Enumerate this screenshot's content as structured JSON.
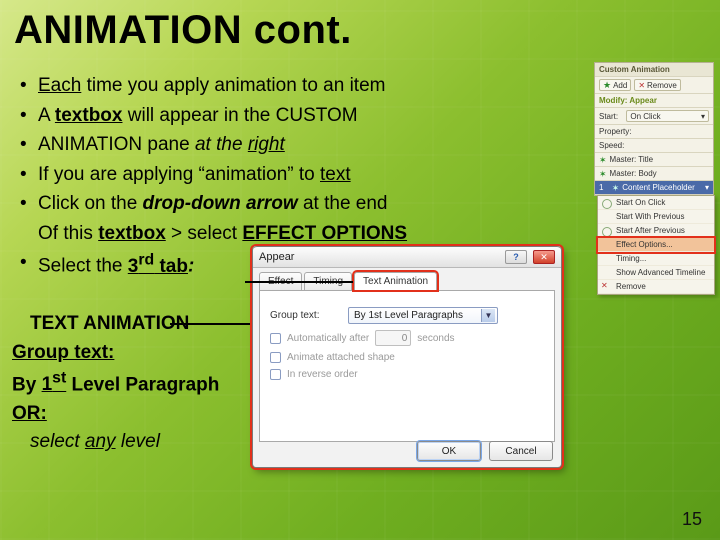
{
  "title": "ANIMATION cont.",
  "bullets": [
    "Each time you apply animation to an item",
    "A textbox will appear in the CUSTOM",
    "ANIMATION pane at the right",
    "If you are applying “animation” to text",
    "Click on the drop-down arrow at the end",
    "Of this textbox > select EFFECT OPTIONS",
    "Select the 3rd tab:"
  ],
  "subtext": {
    "l1": "TEXT ANIMATION",
    "l2": "Group text:",
    "l3": "By 1st Level Paragraph",
    "l4": "OR:",
    "l5": "select any level"
  },
  "pagenum": "15",
  "capane": {
    "header": "Custom Animation",
    "add": "Add",
    "remove": "Remove",
    "modify": "Modify: Appear",
    "start_label": "Start:",
    "start_value": "On Click",
    "prop_label": "Property:",
    "speed_label": "Speed:",
    "items": [
      "Master: Title",
      "Master: Body",
      "Content Placeholder"
    ],
    "sel_index": "1",
    "menu": {
      "m1": "Start On Click",
      "m2": "Start With Previous",
      "m3": "Start After Previous",
      "m4": "Effect Options...",
      "m5": "Timing...",
      "m6": "Show Advanced Timeline",
      "m7": "Remove"
    }
  },
  "dialog": {
    "title": "Appear",
    "tabs": {
      "t1": "Effect",
      "t2": "Timing",
      "t3": "Text Animation"
    },
    "group_label": "Group text:",
    "group_value": "By 1st Level Paragraphs",
    "auto_label": "Automatically after",
    "auto_value": "0",
    "auto_unit": "seconds",
    "shape_label": "Animate attached shape",
    "rev_label": "In reverse order",
    "ok": "OK",
    "cancel": "Cancel"
  }
}
